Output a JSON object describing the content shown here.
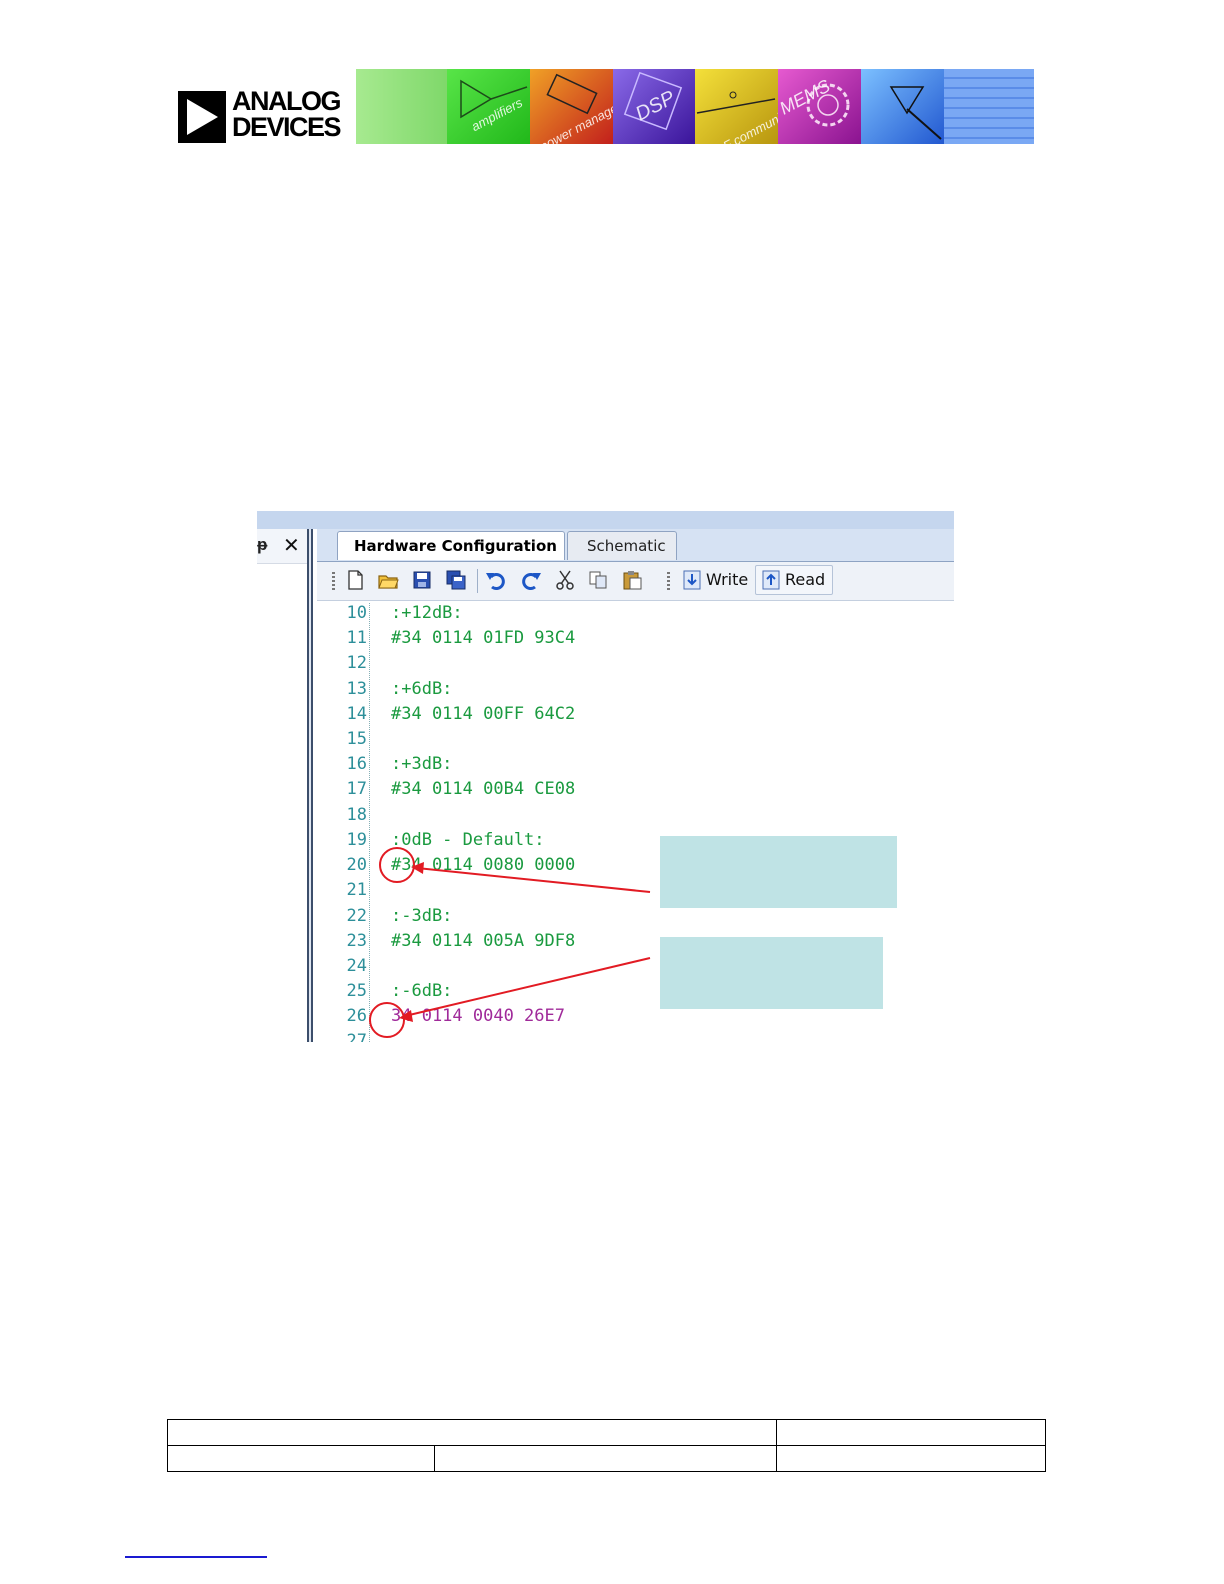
{
  "header": {
    "logo": {
      "line1": "ANALOG",
      "line2": "DEVICES"
    },
    "banner_panels": [
      {
        "label": "",
        "color": "#8fe07a"
      },
      {
        "label": "amplifiers",
        "color": "#31cf2b"
      },
      {
        "label": "power management",
        "color": "#d8401e"
      },
      {
        "label": "DSP",
        "color": "#5a2ac4"
      },
      {
        "label": "RF communications",
        "color": "#e4c41c"
      },
      {
        "label": "MEMS",
        "color": "#cf2bb5"
      },
      {
        "label": "",
        "color": "#3f7fe6"
      },
      {
        "label": "",
        "color": "#6aa0f0"
      }
    ]
  },
  "screenshot": {
    "tabs": [
      {
        "label": "Hardware Configuration",
        "active": true
      },
      {
        "label": "Schematic",
        "active": false
      }
    ],
    "toolbar": {
      "icons": [
        "new-file-icon",
        "open-folder-icon",
        "save-icon",
        "save-all-icon",
        "undo-icon",
        "redo-icon",
        "cut-icon",
        "copy-icon",
        "paste-icon"
      ],
      "write_label": "Write",
      "read_label": "Read"
    },
    "code_lines": [
      {
        "num": "10",
        "text": ":+12dB:"
      },
      {
        "num": "11",
        "text": "#34 0114 01FD 93C4"
      },
      {
        "num": "12",
        "text": ""
      },
      {
        "num": "13",
        "text": ":+6dB:"
      },
      {
        "num": "14",
        "text": "#34 0114 00FF 64C2"
      },
      {
        "num": "15",
        "text": ""
      },
      {
        "num": "16",
        "text": ":+3dB:"
      },
      {
        "num": "17",
        "text": "#34 0114 00B4 CE08"
      },
      {
        "num": "18",
        "text": ""
      },
      {
        "num": "19",
        "text": ":0dB - Default:"
      },
      {
        "num": "20",
        "text": "#34 0114 0080 0000"
      },
      {
        "num": "21",
        "text": ""
      },
      {
        "num": "22",
        "text": ":-3dB:"
      },
      {
        "num": "23",
        "text": "#34 0114 005A 9DF8"
      },
      {
        "num": "24",
        "text": ""
      },
      {
        "num": "25",
        "text": ":-6dB:"
      },
      {
        "num": "26",
        "text": "34 0114 0040 26E7"
      },
      {
        "num": "27",
        "text": ""
      }
    ],
    "colors": {
      "comment_green": "#1a9a3f",
      "active_purple": "#a02a9a",
      "line_number": "#2d8f9a",
      "annotation_red": "#e21b23",
      "callout_fill": "#bfe3e5"
    }
  }
}
